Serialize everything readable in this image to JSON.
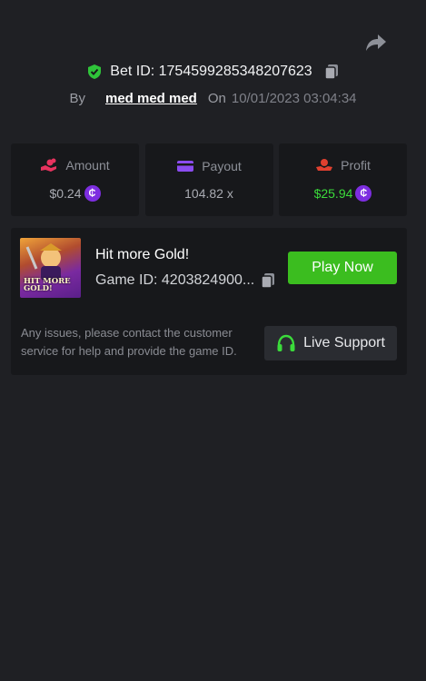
{
  "header": {
    "share_icon": "share-icon",
    "bet_label": "Bet ID: 1754599285348207623",
    "by_label": "By",
    "username": "med med med",
    "on_label": "On",
    "datetime": "10/01/2023 03:04:34"
  },
  "stats": {
    "amount": {
      "label": "Amount",
      "value": "$0.24",
      "icon": "coins-hand-icon"
    },
    "payout": {
      "label": "Payout",
      "value": "104.82 x",
      "icon": "card-icon"
    },
    "profit": {
      "label": "Profit",
      "value": "$25.94",
      "icon": "profit-hand-icon"
    },
    "coin_symbol": "₵"
  },
  "game": {
    "title": "Hit more Gold!",
    "game_id": "Game ID: 4203824900...",
    "thumb_text": "HIT MORE GOLD!",
    "play_label": "Play Now"
  },
  "support": {
    "help_text": "Any issues, please contact the customer service for help and provide the game ID.",
    "button_label": "Live Support"
  },
  "colors": {
    "background": "#1f2024",
    "card": "#17181b",
    "accent_green": "#3bbd1f",
    "profit_green": "#3bdb3b",
    "coin_purple": "#7d2ee0",
    "amount_pink": "#e8335f",
    "payout_purple": "#8b4cf0",
    "profit_red": "#e0402f"
  }
}
